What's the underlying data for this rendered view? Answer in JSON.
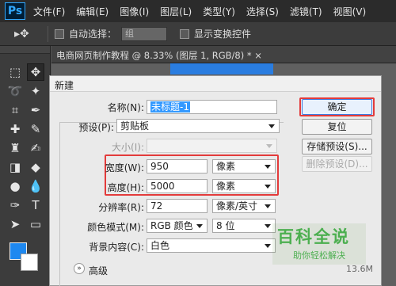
{
  "app": {
    "logo": "Ps"
  },
  "menu": [
    "文件(F)",
    "编辑(E)",
    "图像(I)",
    "图层(L)",
    "类型(Y)",
    "选择(S)",
    "滤镜(T)",
    "视图(V)"
  ],
  "options_bar": {
    "tool_glyph": "▸✥",
    "auto_select_label": "自动选择：",
    "auto_select_value": "组",
    "show_transform_label": "显示变换控件"
  },
  "document_tab": {
    "title": "电商网页制作教程 @ 8.33% (图层 1, RGB/8) * ×"
  },
  "colors": {
    "foreground": "#1e88f0",
    "background": "#ffffff",
    "highlight": "#e33b3b"
  },
  "dialog": {
    "title": "新建",
    "name_label": "名称(N):",
    "name_value": "未标题-1",
    "preset_label": "预设(P):",
    "preset_value": "剪贴板",
    "size_label": "大小(I):",
    "size_value": "",
    "width_label": "宽度(W):",
    "width_value": "950",
    "width_unit": "像素",
    "height_label": "高度(H):",
    "height_value": "5000",
    "height_unit": "像素",
    "resolution_label": "分辨率(R):",
    "resolution_value": "72",
    "resolution_unit": "像素/英寸",
    "color_mode_label": "颜色模式(M):",
    "color_mode_value": "RGB 颜色",
    "bit_depth_value": "8 位",
    "bg_content_label": "背景内容(C):",
    "bg_content_value": "白色",
    "advanced_label": "高级",
    "image_size_value": "13.6M",
    "buttons": {
      "ok": "确定",
      "reset": "复位",
      "save_preset": "存储预设(S)...",
      "delete_preset": "删除预设(D)..."
    }
  },
  "watermark": {
    "title": "百科全说",
    "subtitle": "助你轻松解决"
  }
}
